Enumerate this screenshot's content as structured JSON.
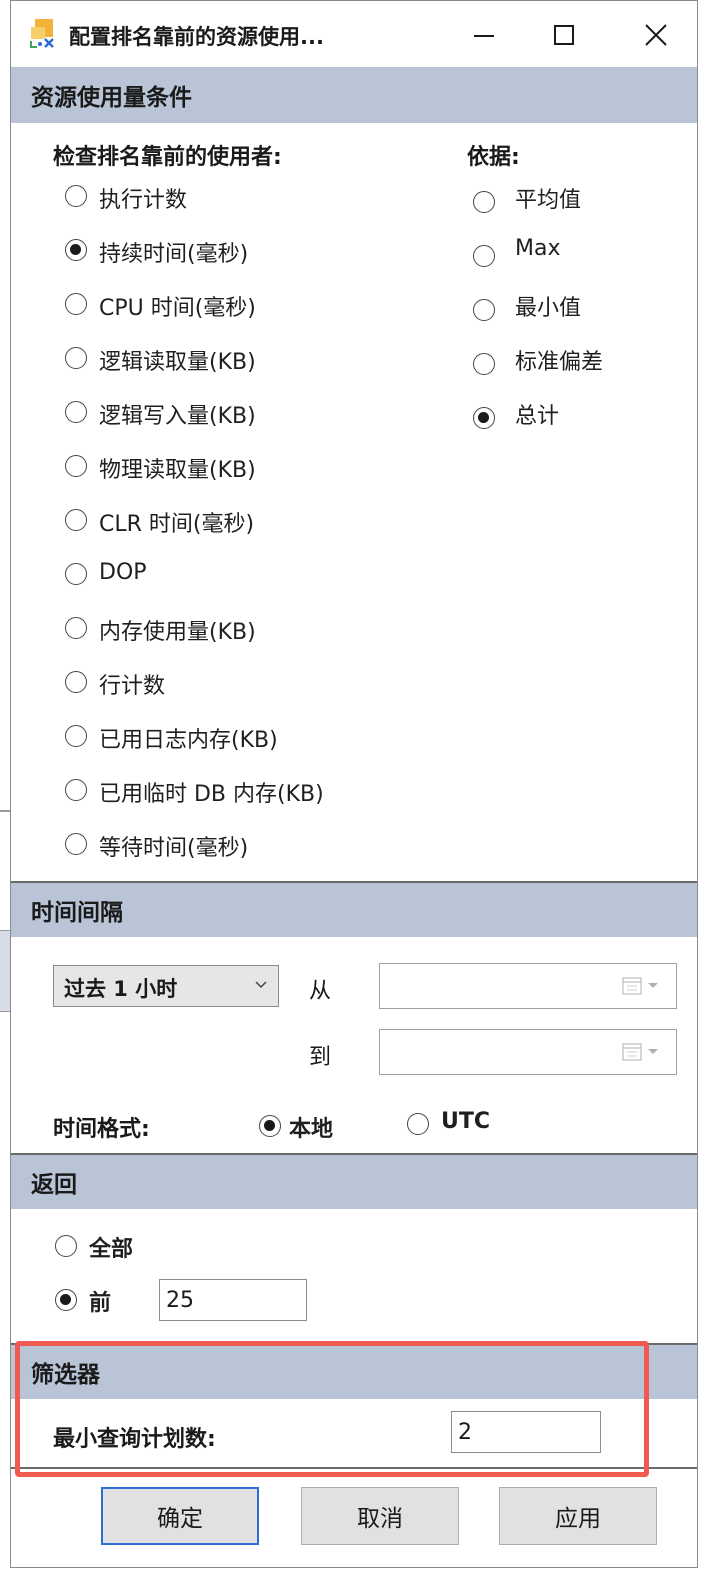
{
  "window": {
    "title": "配置排名靠前的资源使用..."
  },
  "resource_section": {
    "header": "资源使用量条件",
    "check_label": "检查排名靠前的使用者:",
    "basis_label": "依据:",
    "metrics": [
      {
        "label": "执行计数",
        "checked": false
      },
      {
        "label": "持续时间(毫秒)",
        "checked": true
      },
      {
        "label": "CPU 时间(毫秒)",
        "checked": false
      },
      {
        "label": "逻辑读取量(KB)",
        "checked": false
      },
      {
        "label": "逻辑写入量(KB)",
        "checked": false
      },
      {
        "label": "物理读取量(KB)",
        "checked": false
      },
      {
        "label": "CLR 时间(毫秒)",
        "checked": false
      },
      {
        "label": "DOP",
        "checked": false
      },
      {
        "label": "内存使用量(KB)",
        "checked": false
      },
      {
        "label": "行计数",
        "checked": false
      },
      {
        "label": "已用日志内存(KB)",
        "checked": false
      },
      {
        "label": "已用临时 DB 内存(KB)",
        "checked": false
      },
      {
        "label": "等待时间(毫秒)",
        "checked": false
      }
    ],
    "basis": [
      {
        "label": "平均值",
        "checked": false
      },
      {
        "label": "Max",
        "checked": false
      },
      {
        "label": "最小值",
        "checked": false
      },
      {
        "label": "标准偏差",
        "checked": false
      },
      {
        "label": "总计",
        "checked": true
      }
    ]
  },
  "interval_section": {
    "header": "时间间隔",
    "selected": "过去 1 小时",
    "from_label": "从",
    "to_label": "到",
    "from_value": "",
    "to_value": "",
    "time_format_label": "时间格式:",
    "format_local": "本地",
    "format_utc": "UTC",
    "format_selected": "本地"
  },
  "return_section": {
    "header": "返回",
    "all_label": "全部",
    "top_label": "前",
    "top_value": "25",
    "selected": "前"
  },
  "filter_section": {
    "header": "筛选器",
    "min_plan_label": "最小查询计划数:",
    "min_plan_value": "2"
  },
  "buttons": {
    "ok": "确定",
    "cancel": "取消",
    "apply": "应用"
  },
  "colors": {
    "section_header_bg": "#b9c5d6",
    "highlight_border": "#f15a50",
    "default_button_border": "#2b6fd6"
  }
}
